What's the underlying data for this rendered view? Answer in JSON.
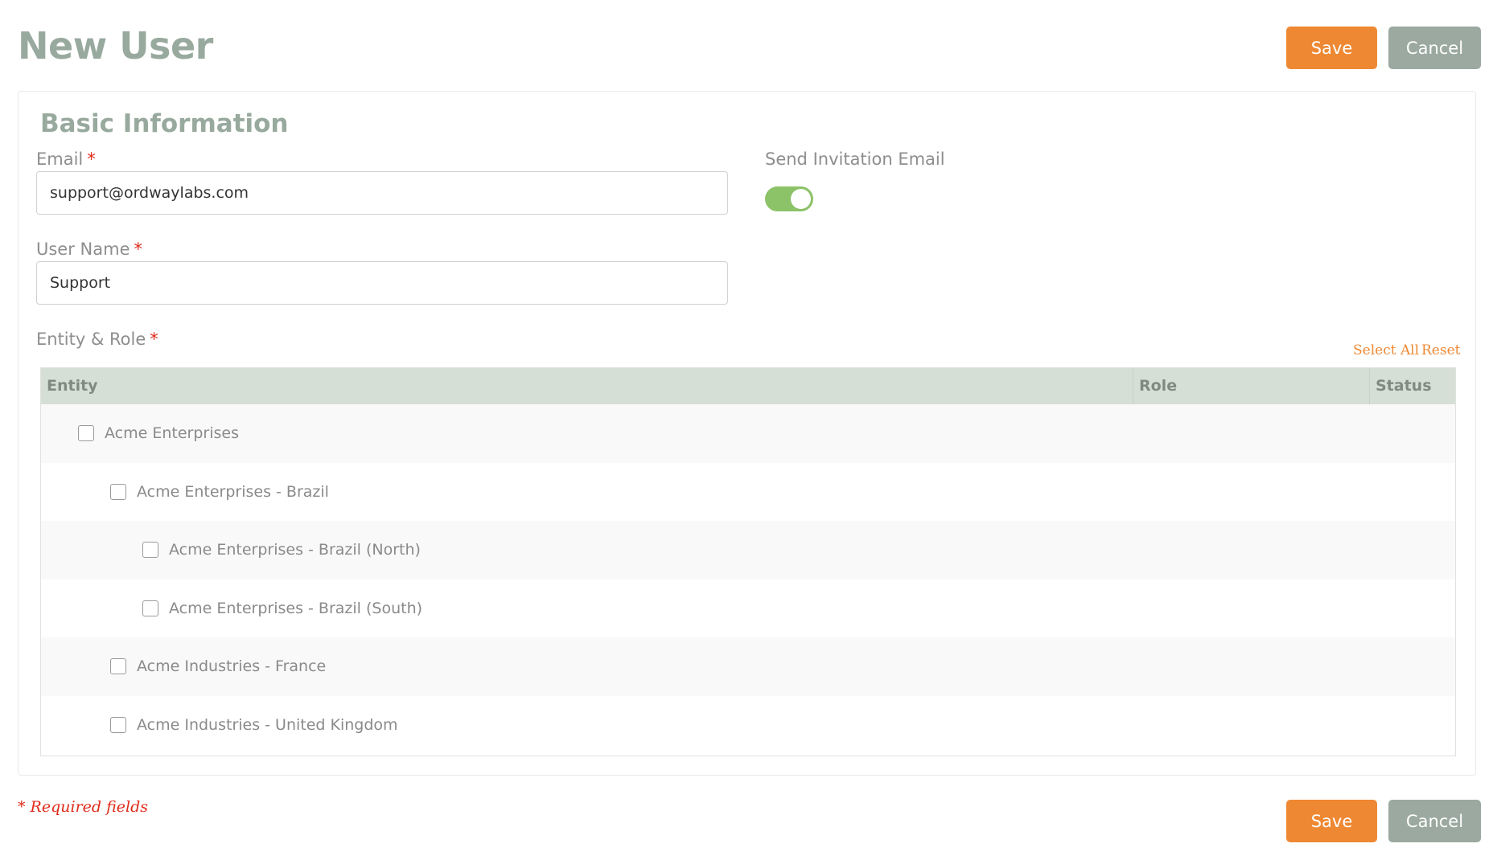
{
  "page": {
    "title": "New User"
  },
  "actions": {
    "save_label": "Save",
    "cancel_label": "Cancel"
  },
  "basic_info": {
    "section_title": "Basic Information",
    "email": {
      "label": "Email",
      "value": "support@ordwaylabs.com",
      "required_marker": "*"
    },
    "user_name": {
      "label": "User Name",
      "value": "Support",
      "required_marker": "*"
    },
    "send_invitation": {
      "label": "Send Invitation Email",
      "enabled": true
    }
  },
  "entity_role": {
    "label": "Entity & Role",
    "required_marker": "*",
    "select_all_label": "Select All",
    "reset_label": "Reset",
    "columns": [
      "Entity",
      "Role",
      "Status"
    ],
    "rows": [
      {
        "name": "Acme Enterprises",
        "level": 0,
        "checked": false
      },
      {
        "name": "Acme Enterprises - Brazil",
        "level": 1,
        "checked": false
      },
      {
        "name": "Acme Enterprises - Brazil (North)",
        "level": 2,
        "checked": false
      },
      {
        "name": "Acme Enterprises - Brazil (South)",
        "level": 2,
        "checked": false
      },
      {
        "name": "Acme Industries - France",
        "level": 1,
        "checked": false
      },
      {
        "name": "Acme Industries - United Kingdom",
        "level": 1,
        "checked": false
      }
    ]
  },
  "footer": {
    "required_note": "* Required fields"
  },
  "colors": {
    "accent_orange": "#ee8833",
    "cancel_gray": "#9ba9a1",
    "title_green_gray": "#98a99e",
    "toggle_green": "#8cc268",
    "required_red": "#e02a1a",
    "table_header_bg": "#d5dfd6"
  }
}
